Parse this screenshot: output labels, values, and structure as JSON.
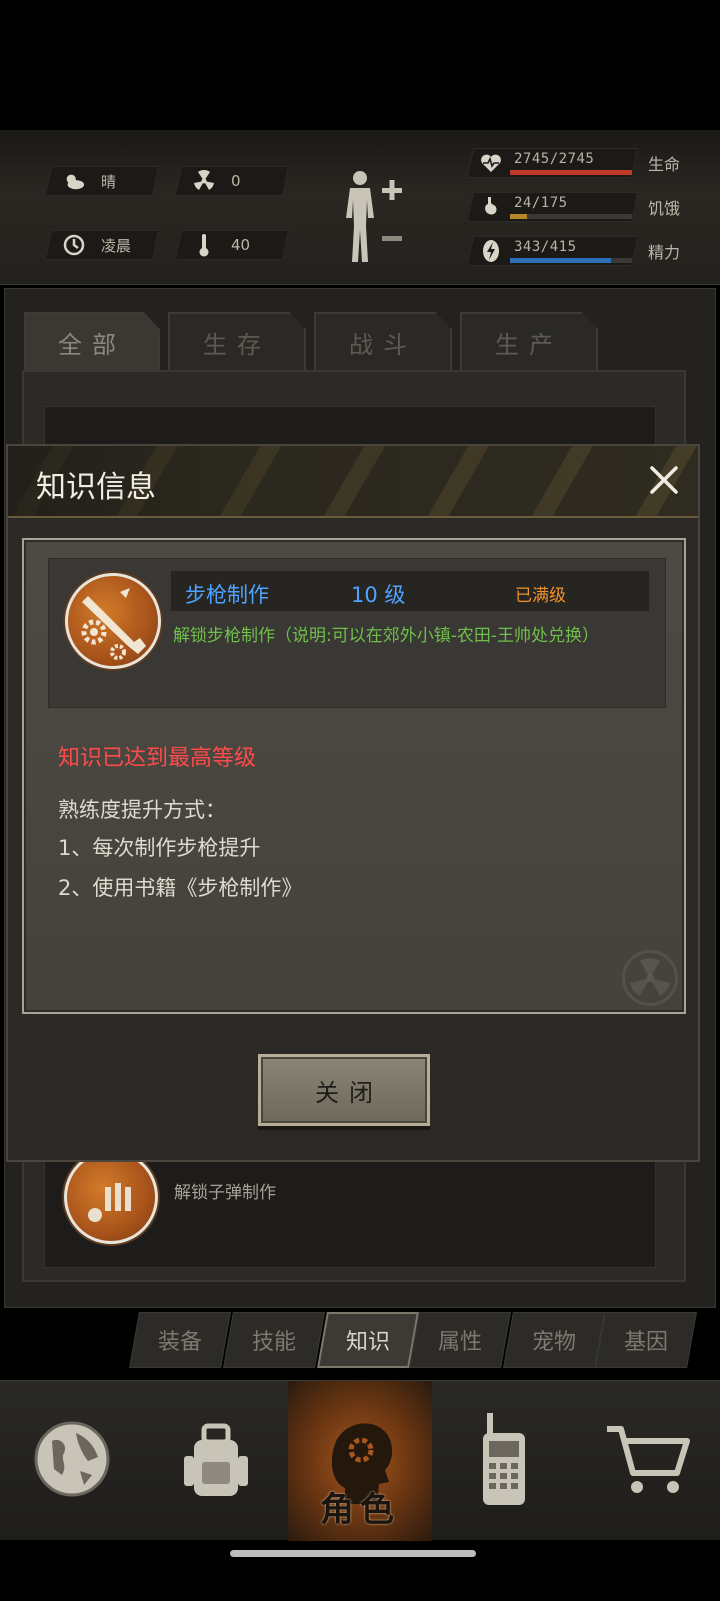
{
  "status": {
    "weather": "晴",
    "radiation": "0",
    "time": "凌晨",
    "temperature": "40"
  },
  "vitals": {
    "life": {
      "value": "2745/2745",
      "label": "生命",
      "fill": 1.0,
      "color": "#c0392b"
    },
    "hunger": {
      "value": "24/175",
      "label": "饥饿",
      "fill": 0.14,
      "color": "#b5862a"
    },
    "energy": {
      "value": "343/415",
      "label": "精力",
      "fill": 0.83,
      "color": "#2f6fb5"
    }
  },
  "tabs": [
    "全部",
    "生存",
    "战斗",
    "生产"
  ],
  "background_item_desc": "解锁子弹制作",
  "modal": {
    "title": "知识信息",
    "item_name": "步枪制作",
    "item_level": "10 级",
    "item_max": "已满级",
    "item_desc": "解锁步枪制作（说明:可以在郊外小镇-农田-王帅处兑换）",
    "max_message": "知识已达到最高等级",
    "method_title": "熟练度提升方式：",
    "method_1": "1、每次制作步枪提升",
    "method_2": "2、使用书籍《步枪制作》",
    "close_label": "关闭"
  },
  "subtabs": [
    "装备",
    "技能",
    "知识",
    "属性",
    "宠物",
    "基因"
  ],
  "subtab_active": "知识",
  "bottom_nav": {
    "role_label": "角色"
  }
}
